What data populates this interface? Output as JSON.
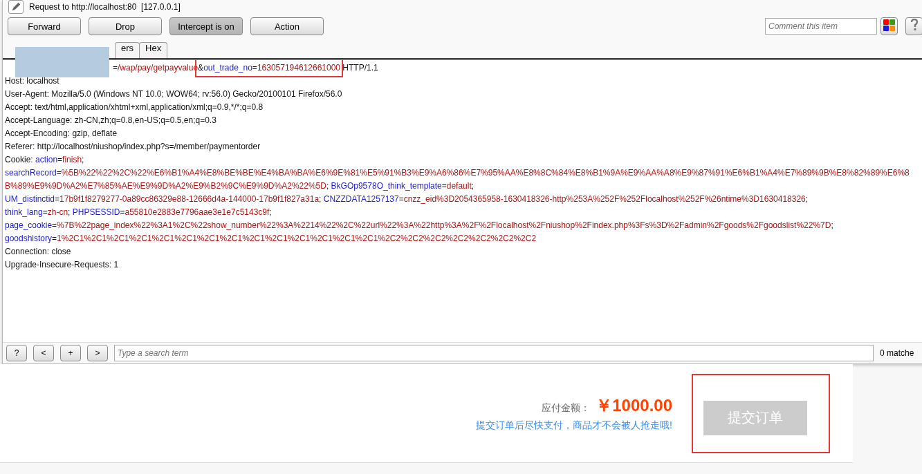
{
  "window": {
    "title": "Request to http://localhost:80  [127.0.0.1]"
  },
  "toolbar": {
    "buttons": [
      {
        "label": "Forward",
        "selected": false
      },
      {
        "label": "Drop",
        "selected": false
      },
      {
        "label": "Intercept is on",
        "selected": true
      },
      {
        "label": "Action",
        "selected": false
      }
    ],
    "comment": {
      "placeholder": "Comment this item"
    }
  },
  "tabs": [
    {
      "label": "ers"
    },
    {
      "label": "Hex"
    }
  ],
  "request": {
    "first_line": {
      "segments": [
        {
          "kind": "plain",
          "text": "="
        },
        {
          "kind": "value",
          "text": "/wap/pay/getpayvalue"
        }
      ],
      "boxed_segments": [
        {
          "kind": "plain",
          "text": "&"
        },
        {
          "kind": "key",
          "text": "out_trade_no"
        },
        {
          "kind": "plain",
          "text": "="
        },
        {
          "kind": "value",
          "text": "163057194612661000"
        }
      ],
      "after_segments": [
        {
          "kind": "plain",
          "text": " HTTP/1.1"
        }
      ]
    },
    "lines": [
      [
        {
          "kind": "plain",
          "text": "Host: localhost"
        }
      ],
      [
        {
          "kind": "plain",
          "text": "User-Agent: Mozilla/5.0 (Windows NT 10.0; WOW64; rv:56.0) Gecko/20100101 Firefox/56.0"
        }
      ],
      [
        {
          "kind": "plain",
          "text": "Accept: text/html,application/xhtml+xml,application/xml;q=0.9,*/*;q=0.8"
        }
      ],
      [
        {
          "kind": "plain",
          "text": "Accept-Language: zh-CN,zh;q=0.8,en-US;q=0.5,en;q=0.3"
        }
      ],
      [
        {
          "kind": "plain",
          "text": "Accept-Encoding: gzip, deflate"
        }
      ],
      [
        {
          "kind": "plain",
          "text": "Referer: http://localhost/niushop/index.php?s=/member/paymentorder"
        }
      ],
      [
        {
          "kind": "plain",
          "text": "Cookie: "
        },
        {
          "kind": "key",
          "text": "action"
        },
        {
          "kind": "plain",
          "text": "="
        },
        {
          "kind": "value",
          "text": "finish"
        },
        {
          "kind": "plain",
          "text": ";"
        }
      ],
      [
        {
          "kind": "key",
          "text": "searchRecord"
        },
        {
          "kind": "plain",
          "text": "="
        },
        {
          "kind": "value",
          "text": "%5B%22%22%2C%22%E6%B1%A4%E8%BE%BE%E4%BA%BA%E6%9E%81%E5%91%B3%E9%A6%86%E7%95%AA%E8%8C%84%E8%B1%9A%E9%AA%A8%E9%87%91%E6%B1%A4%E7%89%9B%E8%82%89%E6%8B%89%E9%9D%A2%E7%85%AE%E9%9D%A2%E9%B2%9C%E9%9D%A2%22%5D"
        },
        {
          "kind": "plain",
          "text": "; "
        },
        {
          "kind": "key",
          "text": "BkGOp9578O_think_template"
        },
        {
          "kind": "plain",
          "text": "="
        },
        {
          "kind": "value",
          "text": "default"
        },
        {
          "kind": "plain",
          "text": ";"
        }
      ],
      [
        {
          "kind": "key",
          "text": "UM_distinctid"
        },
        {
          "kind": "plain",
          "text": "="
        },
        {
          "kind": "value",
          "text": "17b9f1f8279277-0a89cc86329e88-12666d4a-144000-17b9f1f827a31a"
        },
        {
          "kind": "plain",
          "text": "; "
        },
        {
          "kind": "key",
          "text": "CNZZDATA1257137"
        },
        {
          "kind": "plain",
          "text": "="
        },
        {
          "kind": "value",
          "text": "cnzz_eid%3D2054365958-1630418326-http%253A%252F%252Flocalhost%252F%26ntime%3D1630418326"
        },
        {
          "kind": "plain",
          "text": ";"
        }
      ],
      [
        {
          "kind": "key",
          "text": "think_lang"
        },
        {
          "kind": "plain",
          "text": "="
        },
        {
          "kind": "value",
          "text": "zh-cn"
        },
        {
          "kind": "plain",
          "text": "; "
        },
        {
          "kind": "key",
          "text": "PHPSESSID"
        },
        {
          "kind": "plain",
          "text": "="
        },
        {
          "kind": "value",
          "text": "a55810e2883e7796aae3e1e7c5143c9f"
        },
        {
          "kind": "plain",
          "text": ";"
        }
      ],
      [
        {
          "kind": "key",
          "text": "page_cookie"
        },
        {
          "kind": "plain",
          "text": "="
        },
        {
          "kind": "value",
          "text": "%7B%22page_index%22%3A1%2C%22show_number%22%3A%2214%22%2C%22url%22%3A%22http%3A%2F%2Flocalhost%2Fniushop%2Findex.php%3Fs%3D%2Fadmin%2Fgoods%2Fgoodslist%22%7D"
        },
        {
          "kind": "plain",
          "text": ";"
        }
      ],
      [
        {
          "kind": "key",
          "text": "goodshistory"
        },
        {
          "kind": "plain",
          "text": "="
        },
        {
          "kind": "value",
          "text": "1%2C1%2C1%2C1%2C1%2C1%2C1%2C1%2C1%2C1%2C1%2C1%2C1%2C1%2C1%2C2%2C2%2C2%2C2%2C2%2C2%2C2"
        }
      ],
      [
        {
          "kind": "plain",
          "text": "Connection: close"
        }
      ],
      [
        {
          "kind": "plain",
          "text": "Upgrade-Insecure-Requests: 1"
        }
      ]
    ]
  },
  "search_bar": {
    "buttons": [
      "?",
      "<",
      "+",
      ">"
    ],
    "placeholder": "Type a search term",
    "matches": "0 matche"
  },
  "order": {
    "amount_label": "应付金额：",
    "amount": "￥1000.00",
    "note": "提交订单后尽快支付，商品才不会被人抢走哦!",
    "submit": {
      "label": "提交订单",
      "disabled": true
    }
  }
}
